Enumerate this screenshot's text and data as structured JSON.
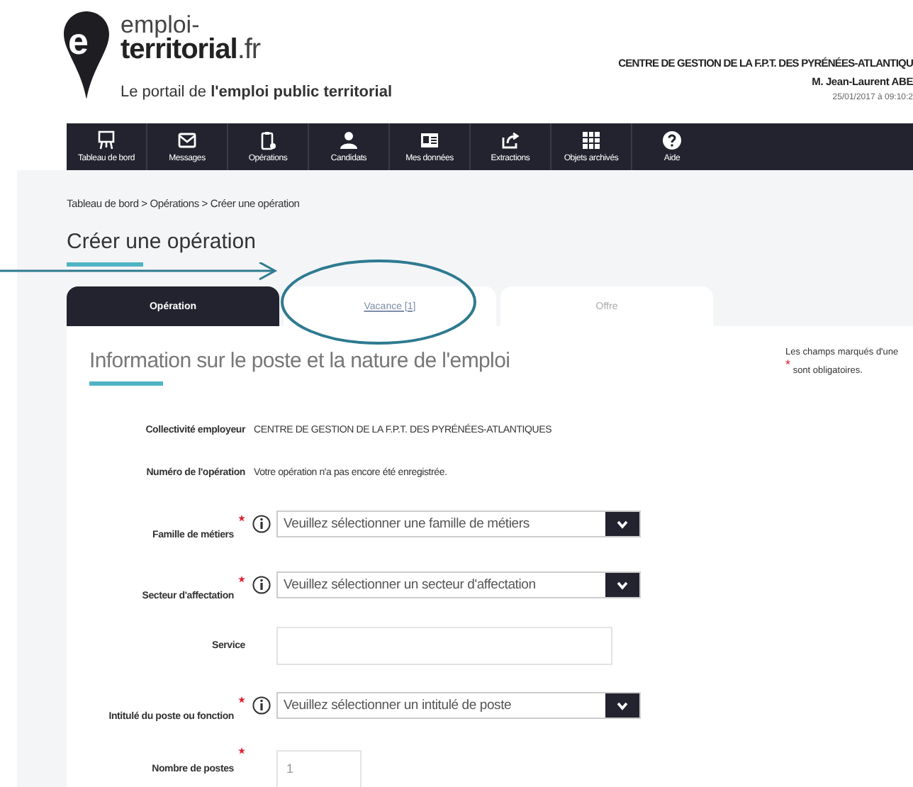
{
  "logo": {
    "letter": "e",
    "line1": "emploi-",
    "line2": "territorial",
    "suffix": ".fr",
    "tagline": "Le portail de **l'emploi public territorial**"
  },
  "header": {
    "organisation": "CENTRE DE GESTION DE LA F.P.T. DES PYRÉNÉES-ATLANTIQU",
    "user": "M. Jean-Laurent ABE",
    "timestamp": "25/01/2017 à 09:10:2"
  },
  "nav": [
    {
      "label": "Tableau de bord",
      "kind": "easel"
    },
    {
      "label": "Messages",
      "kind": "mail"
    },
    {
      "label": "Opérations",
      "kind": "clipboard"
    },
    {
      "label": "Candidats",
      "kind": "person"
    },
    {
      "label": "Mes données",
      "kind": "card"
    },
    {
      "label": "Extractions",
      "kind": "export"
    },
    {
      "label": "Objets archivés",
      "kind": "cabinet"
    },
    {
      "label": "Aide",
      "kind": "help"
    }
  ],
  "breadcrumb": "Tableau de bord > Opérations > Créer une opération",
  "page_title": "Créer une opération",
  "tabs": [
    {
      "label": "Opération",
      "selected": true
    },
    {
      "label": "Vacance [1]",
      "selected": false,
      "link": true
    },
    {
      "label": "Offre",
      "selected": false,
      "link": false
    }
  ],
  "section_title": "Information sur le poste et la nature de l'emploi",
  "required_note": "Les champs marqués d'une $^{*}$ sont obligatoires.",
  "fields": [
    {
      "label": "Collectivité employeur",
      "kind": "text",
      "value": "CENTRE DE GESTION DE LA F.P.T. DES PYRÉNÉES-ATLANTIQUES",
      "required": false,
      "info": false
    },
    {
      "label": "Numéro de l'opération",
      "kind": "text",
      "value": "Votre opération n'a pas encore été enregistrée.",
      "required": false,
      "info": false
    },
    {
      "label": "Famille de métiers",
      "kind": "select",
      "placeholder": "Veuillez sélectionner une famille de métiers",
      "required": true,
      "info": true
    },
    {
      "label": "Secteur d'affectation",
      "kind": "select",
      "placeholder": "Veuillez sélectionner un secteur d'affectation",
      "required": true,
      "info": true
    },
    {
      "label": "Service",
      "kind": "input",
      "required": false,
      "info": false
    },
    {
      "label": "Intitulé du poste ou fonction",
      "kind": "select",
      "placeholder": "Veuillez sélectionner un intitulé de poste",
      "required": true,
      "info": true
    },
    {
      "label": "Nombre de postes",
      "kind": "short-input",
      "placeholder": "1",
      "required": true,
      "info": false
    }
  ]
}
